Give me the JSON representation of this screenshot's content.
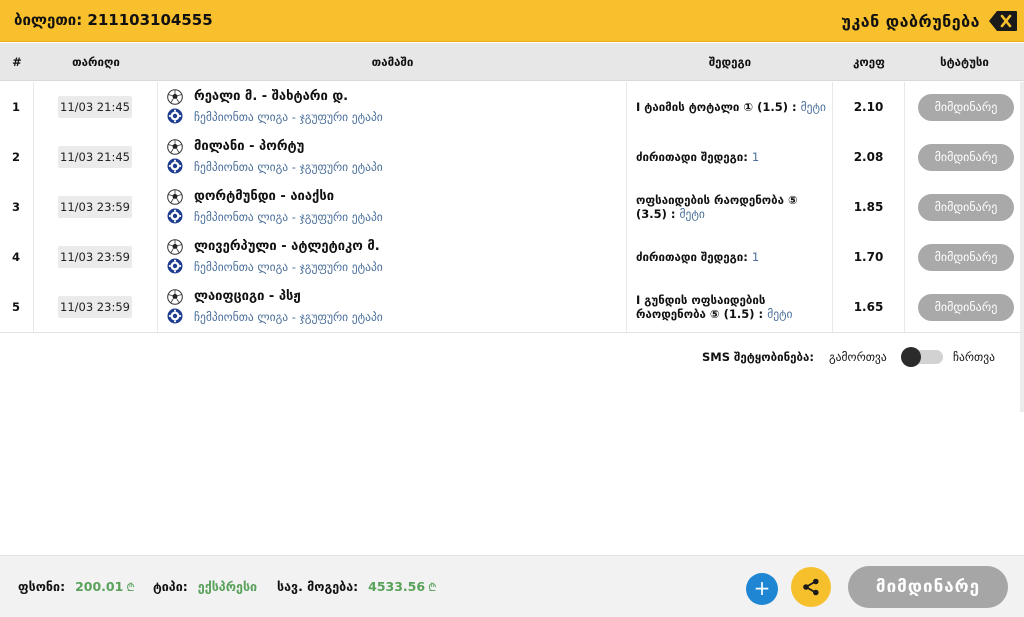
{
  "header": {
    "ticket_label": "ბილეთი: 211103104555",
    "back_label": "უკან დაბრუნება"
  },
  "table": {
    "columns": [
      "#",
      "თარიღი",
      "თამაში",
      "შედეგი",
      "კოეფ",
      "სტატუსი"
    ],
    "rows": [
      {
        "num": "1",
        "date": "11/03 21:45",
        "match": "რეალი მ. - შახტარი დ.",
        "league": "ჩემპიონთა ლიგა - ჯგუფური ეტაპი",
        "result": "I ტაიმის ტოტალი ① (1.5) :",
        "result_value": "მეტი",
        "odd": "2.10",
        "status": "მიმდინარე"
      },
      {
        "num": "2",
        "date": "11/03 21:45",
        "match": "მილანი - პორტუ",
        "league": "ჩემპიონთა ლიგა - ჯგუფური ეტაპი",
        "result": "ძირითადი შედეგი:",
        "result_value": "1",
        "odd": "2.08",
        "status": "მიმდინარე"
      },
      {
        "num": "3",
        "date": "11/03 23:59",
        "match": "დორტმუნდი - აიაქსი",
        "league": "ჩემპიონთა ლიგა - ჯგუფური ეტაპი",
        "result": "ოფსაიდების რაოდენობა ⑤ (3.5) :",
        "result_value": "მეტი",
        "odd": "1.85",
        "status": "მიმდინარე"
      },
      {
        "num": "4",
        "date": "11/03 23:59",
        "match": "ლივერპული - ატლეტიკო მ.",
        "league": "ჩემპიონთა ლიგა - ჯგუფური ეტაპი",
        "result": "ძირითადი შედეგი:",
        "result_value": "1",
        "odd": "1.70",
        "status": "მიმდინარე"
      },
      {
        "num": "5",
        "date": "11/03 23:59",
        "match": "ლაიფციგი - პსჟ",
        "league": "ჩემპიონთა ლიგა - ჯგუფური ეტაპი",
        "result": "I გუნდის ოფსაიდების რაოდენობა ⑤ (1.5) :",
        "result_value": "მეტი",
        "odd": "1.65",
        "status": "მიმდინარე"
      }
    ]
  },
  "sms": {
    "label": "SMS შეტყობინება:",
    "off_label": "გამორთვა",
    "on_label": "ჩართვა",
    "enabled": false
  },
  "footer": {
    "stake_label": "ფსონი:",
    "stake_value": "200.01",
    "type_label": "ტიპი:",
    "type_value": "ექსპრესი",
    "win_label": "სავ. მოგება:",
    "win_value": "4533.56",
    "currency": "₾",
    "plus_label": "+",
    "status_label": "მიმდინარე"
  },
  "icons": {
    "back": "backspace-icon",
    "sport": "soccer-ball-icon",
    "league": "champions-league-icon",
    "share": "share-icon",
    "add": "plus-icon"
  },
  "colors": {
    "accent_yellow": "#f7c02c",
    "status_gray": "#a9a9a9",
    "value_green": "#5aa15b",
    "link_blue": "#4a6f9a",
    "add_blue": "#1e86d3"
  }
}
